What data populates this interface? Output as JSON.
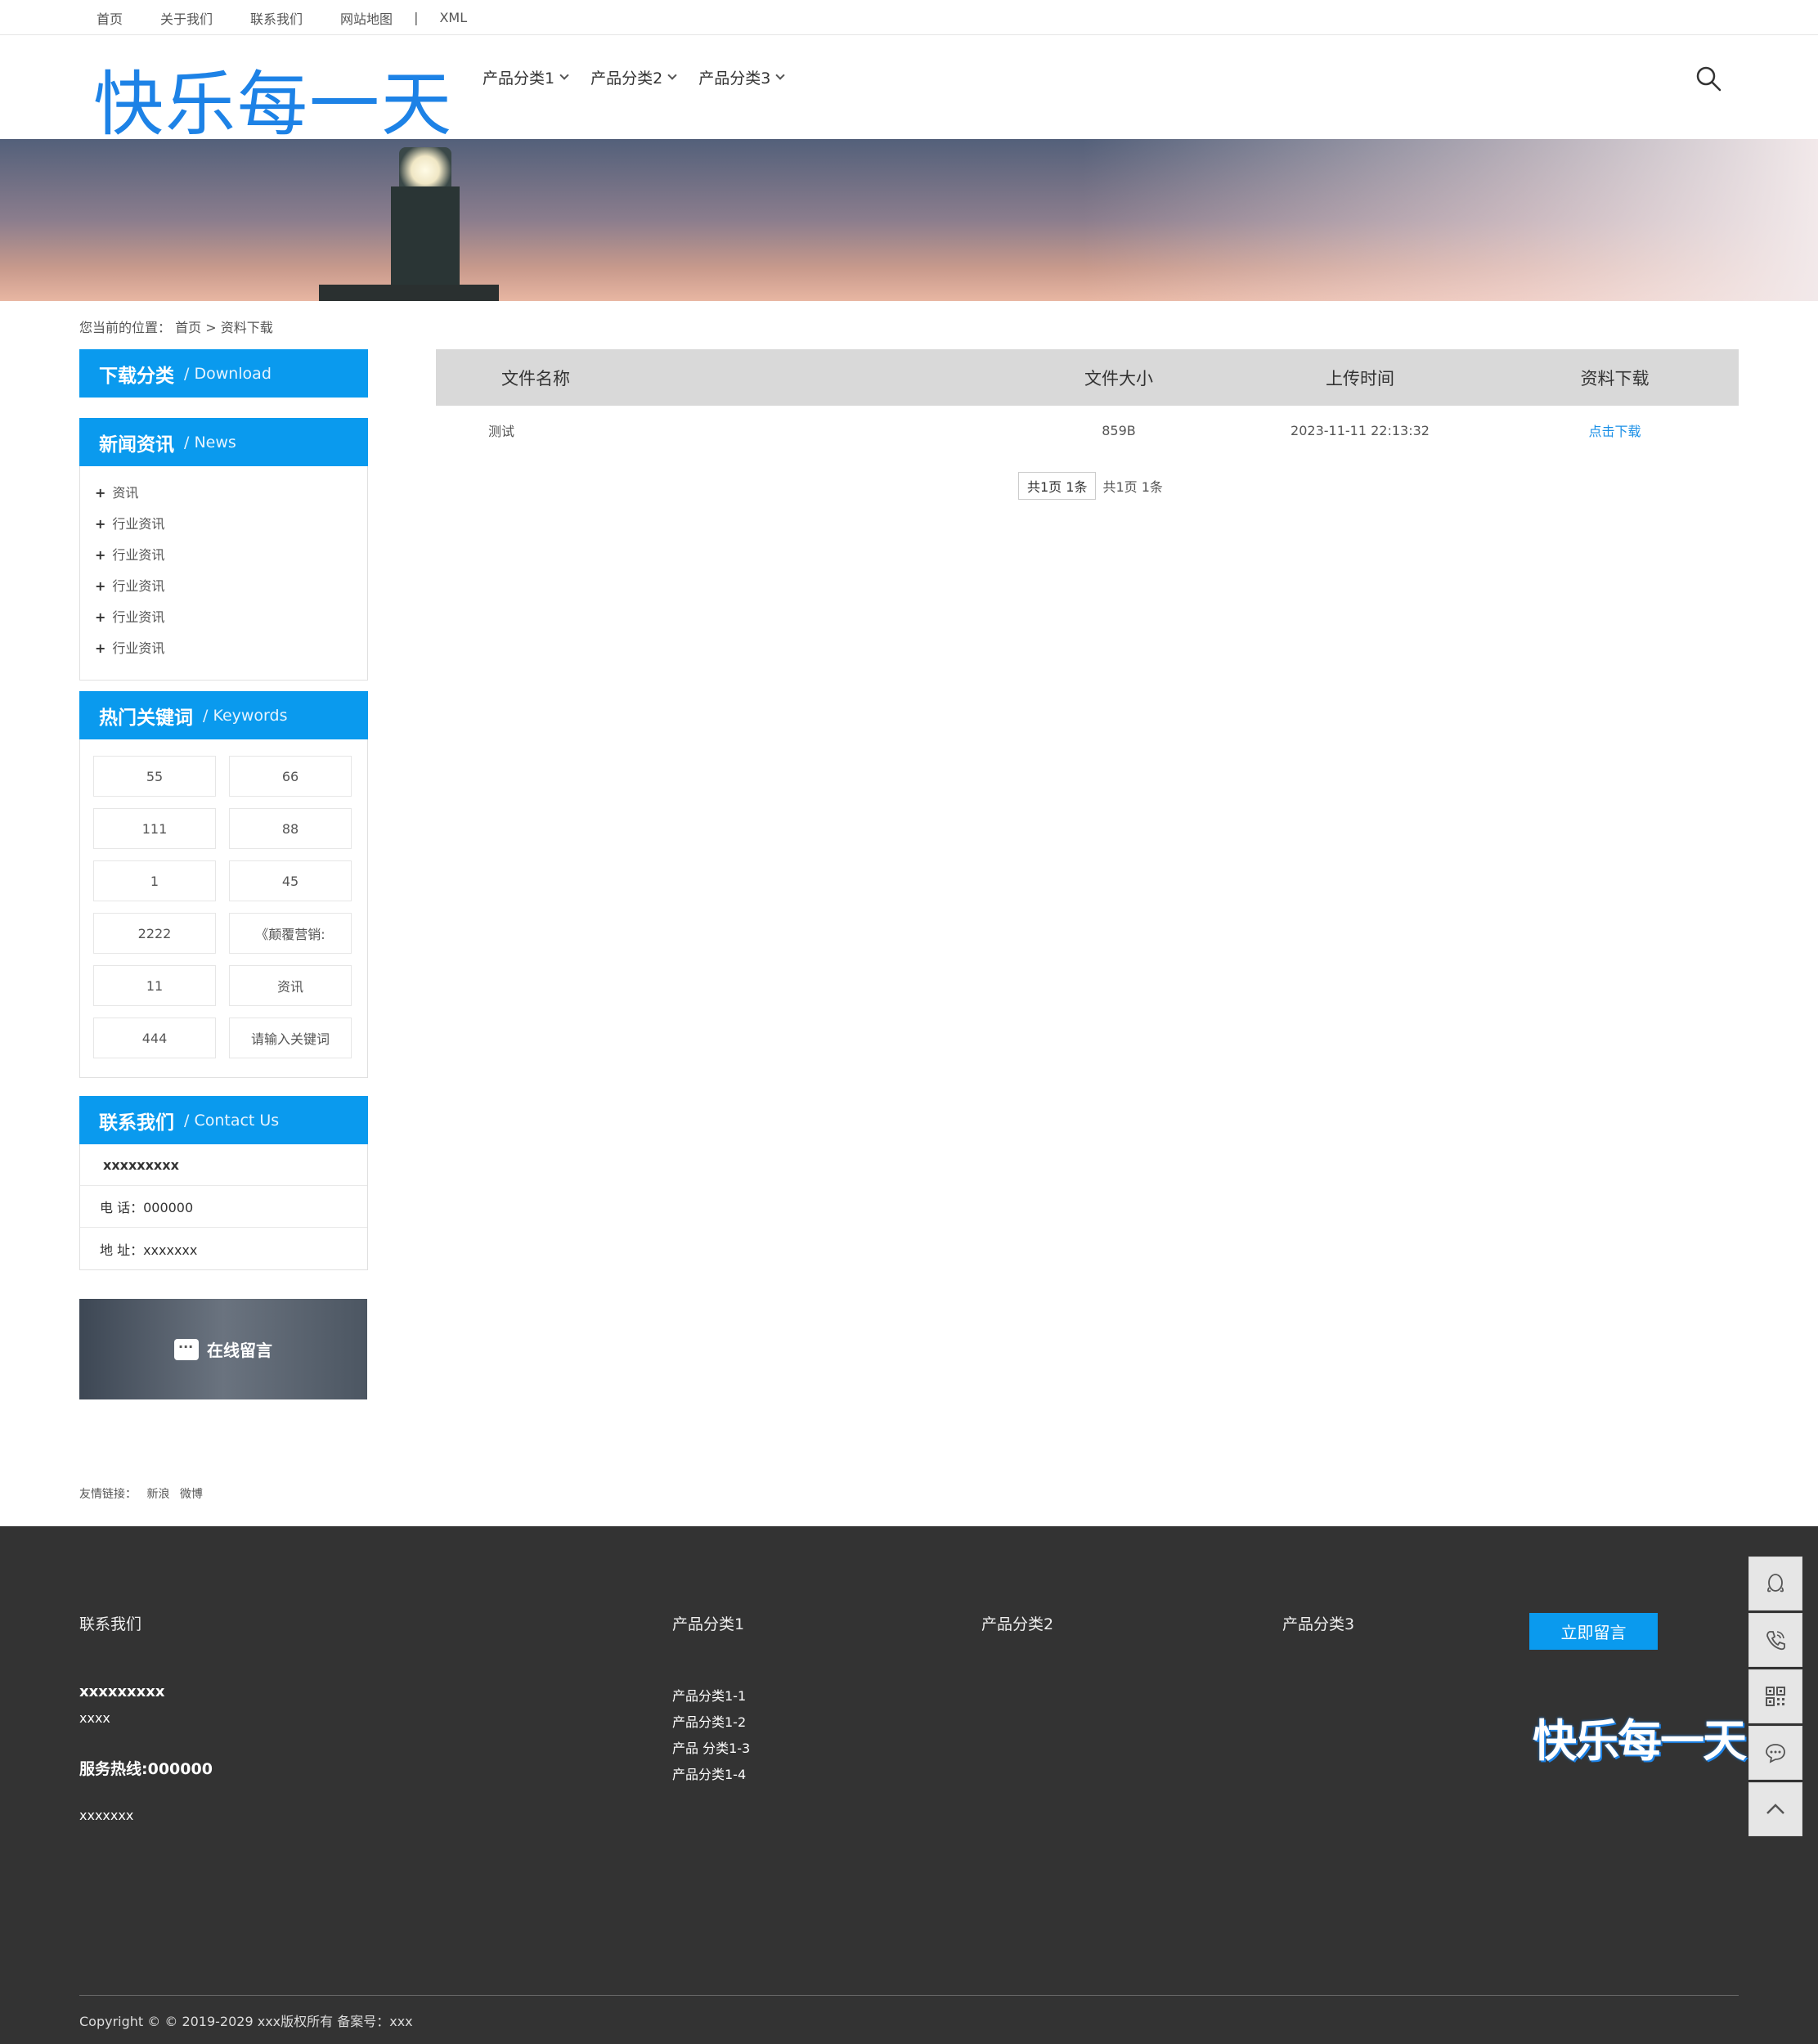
{
  "topbar": {
    "links": [
      "首页",
      "关于我们",
      "联系我们",
      "网站地图"
    ],
    "separator": "|",
    "xml": "XML"
  },
  "header": {
    "logo": "快乐每一天",
    "nav": [
      "产品分类1",
      "产品分类2",
      "产品分类3"
    ]
  },
  "breadcrumb": {
    "prefix": "您当前的位置：",
    "home": "首页",
    "sep": ">",
    "current": "资料下载"
  },
  "sidebar": {
    "download": {
      "cn": "下载分类",
      "en": "/ Download"
    },
    "news": {
      "cn": "新闻资讯",
      "en": "/ News",
      "items": [
        "资讯",
        "行业资讯",
        "行业资讯",
        "行业资讯",
        "行业资讯",
        "行业资讯"
      ]
    },
    "keywords": {
      "cn": "热门关键词",
      "en": "/ Keywords",
      "items": [
        "55",
        "66",
        "111",
        "88",
        "1",
        "45",
        "2222",
        "《颠覆营销:",
        "11",
        "资讯",
        "444",
        "请输入关键词"
      ]
    },
    "contact": {
      "cn": "联系我们",
      "en": "/ Contact Us",
      "name": "xxxxxxxxx",
      "phone": "电 话：000000",
      "address": "地 址：xxxxxxx"
    },
    "message_banner": "在线留言"
  },
  "table": {
    "headers": [
      "文件名称",
      "文件大小",
      "上传时间",
      "资料下载"
    ],
    "rows": [
      {
        "name": "测试",
        "size": "859B",
        "time": "2023-11-11 22:13:32",
        "link": "点击下载"
      }
    ]
  },
  "pager": {
    "box": "共1页 1条",
    "text": "共1页 1条"
  },
  "friend_links": {
    "label": "友情链接：",
    "items": [
      "新浪",
      "微博"
    ]
  },
  "footer": {
    "contact_title": "联系我们",
    "company": "xxxxxxxxx",
    "line2": "xxxx",
    "hotline": "服务热线:000000",
    "line4": "xxxxxxx",
    "col1_title": "产品分类1",
    "col1_items": [
      "产品分类1-1",
      "产品分类1-2",
      "产品 分类1-3",
      "产品分类1-4"
    ],
    "col2_title": "产品分类2",
    "col3_title": "产品分类3",
    "leave_button": "立即留言",
    "logo": "快乐每一天",
    "copyright": "Copyright © © 2019-2029 xxx版权所有 备案号：xxx"
  },
  "float_tools": [
    "qq-icon",
    "phone-icon",
    "qrcode-icon",
    "chat-icon",
    "back-to-top-icon"
  ],
  "colors": {
    "accent": "#0a9aee",
    "logo": "#1d82e6",
    "footer_bg": "#333333"
  }
}
